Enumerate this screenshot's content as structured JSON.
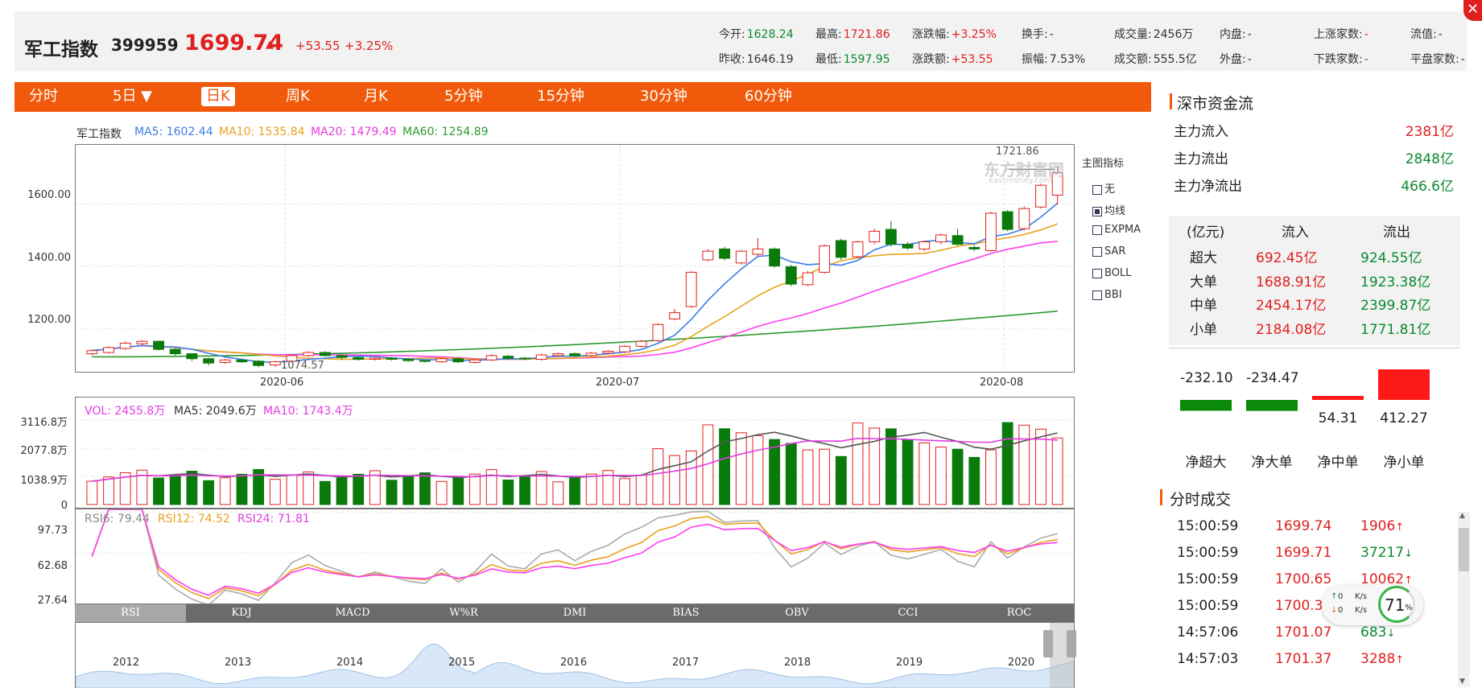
{
  "header": {
    "name": "军工指数",
    "code": "399959",
    "price": "1699.74",
    "arrow": "▲",
    "change": "+53.55",
    "change_pct": "+3.25%",
    "stats": [
      {
        "label": "今开:",
        "value": "1628.24",
        "color": "green"
      },
      {
        "label": "最高:",
        "value": "1721.86",
        "color": "red"
      },
      {
        "label": "涨跌幅:",
        "value": "+3.25%",
        "color": "red"
      },
      {
        "label": "换手:",
        "value": "-",
        "color": "none"
      },
      {
        "label": "成交量:",
        "value": "2456万",
        "color": "none"
      },
      {
        "label": "内盘:",
        "value": "-",
        "color": "none"
      },
      {
        "label": "上涨家数:",
        "value": "-",
        "color": "red"
      },
      {
        "label": "流值:",
        "value": "-",
        "color": "none"
      },
      {
        "label": "昨收:",
        "value": "1646.19",
        "color": "none"
      },
      {
        "label": "最低:",
        "value": "1597.95",
        "color": "green"
      },
      {
        "label": "涨跌额:",
        "value": "+53.55",
        "color": "red"
      },
      {
        "label": "振幅:",
        "value": "7.53%",
        "color": "none"
      },
      {
        "label": "成交额:",
        "value": "555.5亿",
        "color": "none"
      },
      {
        "label": "外盘:",
        "value": "-",
        "color": "none"
      },
      {
        "label": "下跌家数:",
        "value": "-",
        "color": "green"
      },
      {
        "label": "平盘家数:",
        "value": "-",
        "color": "none"
      }
    ]
  },
  "toolbar": {
    "tabs": [
      "分时",
      "5日 ▼",
      "日K",
      "周K",
      "月K",
      "5分钟",
      "15分钟",
      "30分钟",
      "60分钟"
    ],
    "active": 2
  },
  "kline": {
    "legend": {
      "name": "军工指数",
      "ma5": "MA5: 1602.44",
      "ma10": "MA10: 1535.84",
      "ma20": "MA20: 1479.49",
      "ma60": "MA60: 1254.89"
    },
    "y_ticks": [
      "1600.00",
      "1400.00",
      "1200.00"
    ],
    "x_ticks": [
      "2020-06",
      "2020-07",
      "2020-08"
    ],
    "high_label": "1721.86",
    "low_label": "1074.57",
    "watermark": "东方财富网",
    "watermark_sub": "eastmoney.com",
    "indicator_title": "主图指标",
    "indicators": [
      {
        "label": "无",
        "checked": false
      },
      {
        "label": "均线",
        "checked": true
      },
      {
        "label": "EXPMA",
        "checked": false
      },
      {
        "label": "SAR",
        "checked": false
      },
      {
        "label": "BOLL",
        "checked": false
      },
      {
        "label": "BBI",
        "checked": false
      }
    ]
  },
  "volume": {
    "legend": {
      "vol": "VOL: 2455.8万",
      "ma5": "MA5: 2049.6万",
      "ma10": "MA10: 1743.4万"
    },
    "y_ticks": [
      "3116.8万",
      "2077.8万",
      "1038.9万",
      "0"
    ]
  },
  "rsi": {
    "legend": {
      "rsi6": "RSI6: 79.44",
      "rsi12": "RSI12: 74.52",
      "rsi24": "RSI24: 71.81"
    },
    "y_ticks": [
      "97.73",
      "62.68",
      "27.64"
    ]
  },
  "indicator_tabs": [
    "RSI",
    "KDJ",
    "MACD",
    "W%R",
    "DMI",
    "BIAS",
    "OBV",
    "CCI",
    "ROC"
  ],
  "overview_years": [
    "2012",
    "2013",
    "2014",
    "2015",
    "2016",
    "2017",
    "2018",
    "2019",
    "2020"
  ],
  "capital_flow": {
    "title": "深市资金流",
    "rows": [
      {
        "label": "主力流入",
        "value": "2381亿",
        "color": "red"
      },
      {
        "label": "主力流出",
        "value": "2848亿",
        "color": "green"
      },
      {
        "label": "主力净流出",
        "value": "466.6亿",
        "color": "green"
      }
    ],
    "table_head": [
      "(亿元)",
      "流入",
      "流出"
    ],
    "table_rows": [
      {
        "label": "超大",
        "in": "692.45亿",
        "out": "924.55亿"
      },
      {
        "label": "大单",
        "in": "1688.91亿",
        "out": "1923.38亿"
      },
      {
        "label": "中单",
        "in": "2454.17亿",
        "out": "2399.87亿"
      },
      {
        "label": "小单",
        "in": "2184.08亿",
        "out": "1771.81亿"
      }
    ],
    "net_bars": [
      {
        "label": "净超大",
        "value": "-232.10"
      },
      {
        "label": "净大单",
        "value": "-234.47"
      },
      {
        "label": "净中单",
        "value": "54.31"
      },
      {
        "label": "净小单",
        "value": "412.27"
      }
    ]
  },
  "trades": {
    "title": "分时成交",
    "rows": [
      {
        "time": "15:00:59",
        "price": "1699.74",
        "vol": "1906",
        "dir": "↑",
        "color": "red"
      },
      {
        "time": "15:00:59",
        "price": "1699.71",
        "vol": "37217",
        "dir": "↓",
        "color": "green"
      },
      {
        "time": "15:00:59",
        "price": "1700.65",
        "vol": "10062",
        "dir": "↑",
        "color": "red"
      },
      {
        "time": "15:00:59",
        "price": "1700.3",
        "vol": "",
        "dir": "",
        "color": "red"
      },
      {
        "time": "14:57:06",
        "price": "1701.07",
        "vol": "683",
        "dir": "↓",
        "color": "green"
      },
      {
        "time": "14:57:03",
        "price": "1701.37",
        "vol": "3288",
        "dir": "↑",
        "color": "red"
      }
    ]
  },
  "speed_widget": {
    "up": "0",
    "up_unit": "K/s",
    "down": "0",
    "down_unit": "K/s",
    "percent": "71",
    "percent_unit": "%"
  },
  "chart_data": {
    "type": "candlestick",
    "x_ticks": [
      "2020-06",
      "2020-07",
      "2020-08"
    ],
    "y_ticks": [
      1200,
      1400,
      1600
    ],
    "ylim": [
      1060,
      1790
    ],
    "candles": [
      [
        1118,
        1128,
        1112,
        1132
      ],
      [
        1122,
        1138,
        1118,
        1142
      ],
      [
        1135,
        1152,
        1130,
        1158
      ],
      [
        1150,
        1158,
        1145,
        1162
      ],
      [
        1158,
        1132,
        1128,
        1160
      ],
      [
        1132,
        1118,
        1112,
        1135
      ],
      [
        1118,
        1102,
        1095,
        1120
      ],
      [
        1102,
        1088,
        1080,
        1105
      ],
      [
        1090,
        1098,
        1085,
        1102
      ],
      [
        1098,
        1092,
        1088,
        1102
      ],
      [
        1094,
        1080,
        1074.57,
        1098
      ],
      [
        1082,
        1092,
        1076,
        1096
      ],
      [
        1094,
        1112,
        1090,
        1116
      ],
      [
        1112,
        1122,
        1108,
        1126
      ],
      [
        1122,
        1112,
        1108,
        1126
      ],
      [
        1112,
        1106,
        1100,
        1116
      ],
      [
        1106,
        1100,
        1096,
        1110
      ],
      [
        1100,
        1104,
        1096,
        1108
      ],
      [
        1104,
        1100,
        1096,
        1108
      ],
      [
        1100,
        1096,
        1092,
        1104
      ],
      [
        1096,
        1094,
        1090,
        1100
      ],
      [
        1092,
        1102,
        1088,
        1106
      ],
      [
        1102,
        1092,
        1088,
        1106
      ],
      [
        1090,
        1098,
        1086,
        1102
      ],
      [
        1098,
        1112,
        1094,
        1116
      ],
      [
        1110,
        1104,
        1100,
        1114
      ],
      [
        1104,
        1102,
        1098,
        1108
      ],
      [
        1100,
        1114,
        1096,
        1118
      ],
      [
        1112,
        1118,
        1108,
        1122
      ],
      [
        1118,
        1112,
        1108,
        1122
      ],
      [
        1112,
        1120,
        1108,
        1124
      ],
      [
        1120,
        1126,
        1116,
        1130
      ],
      [
        1124,
        1142,
        1120,
        1146
      ],
      [
        1142,
        1158,
        1138,
        1162
      ],
      [
        1160,
        1212,
        1156,
        1216
      ],
      [
        1230,
        1250,
        1225,
        1262
      ],
      [
        1270,
        1380,
        1265,
        1384
      ],
      [
        1420,
        1448,
        1415,
        1455
      ],
      [
        1455,
        1425,
        1418,
        1462
      ],
      [
        1410,
        1448,
        1405,
        1452
      ],
      [
        1438,
        1455,
        1430,
        1490
      ],
      [
        1455,
        1400,
        1395,
        1460
      ],
      [
        1398,
        1342,
        1335,
        1404
      ],
      [
        1340,
        1378,
        1335,
        1384
      ],
      [
        1380,
        1465,
        1375,
        1470
      ],
      [
        1482,
        1428,
        1420,
        1488
      ],
      [
        1430,
        1478,
        1425,
        1482
      ],
      [
        1478,
        1512,
        1470,
        1520
      ],
      [
        1518,
        1470,
        1462,
        1545
      ],
      [
        1470,
        1458,
        1452,
        1478
      ],
      [
        1455,
        1478,
        1448,
        1482
      ],
      [
        1478,
        1500,
        1470,
        1505
      ],
      [
        1498,
        1470,
        1465,
        1520
      ],
      [
        1460,
        1455,
        1448,
        1468
      ],
      [
        1450,
        1570,
        1446,
        1575
      ],
      [
        1575,
        1518,
        1512,
        1580
      ],
      [
        1520,
        1585,
        1515,
        1592
      ],
      [
        1590,
        1660,
        1585,
        1665
      ],
      [
        1628.24,
        1699.74,
        1597.95,
        1721.86
      ]
    ],
    "ma5_end": 1602.44,
    "ma10_end": 1535.84,
    "ma20_end": 1479.49,
    "ma60_end": 1254.89,
    "volume_max": 3116.8,
    "volume_last": 2455.8
  }
}
